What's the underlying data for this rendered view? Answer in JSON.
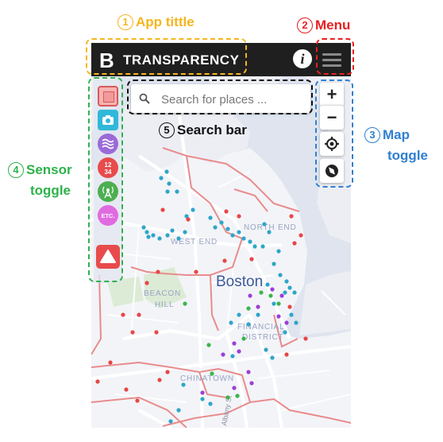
{
  "app": {
    "logo_letter": "B",
    "title": "TRANSPARENCY",
    "info_glyph": "i"
  },
  "search": {
    "placeholder": "Search for places ..."
  },
  "map_controls": {
    "zoom_in": "+",
    "zoom_out": "−"
  },
  "map_labels": {
    "city": "Boston",
    "west_end": "WEST END",
    "north_end": "NORTH END",
    "beacon_hill": [
      "BEACON",
      "HILL"
    ],
    "financial_district": [
      "FINANCIAL",
      "DISTRICT"
    ],
    "chinatown": "CHINATOWN",
    "street": "Albany St"
  },
  "sensors": [
    {
      "name": "square-sensor",
      "icon": "square-icon",
      "color": "#f4a0a0"
    },
    {
      "name": "camera-sensor",
      "icon": "camera-icon",
      "color": "#30b8d8"
    },
    {
      "name": "wave-sensor",
      "icon": "wave-icon",
      "color": "#9b6ad8"
    },
    {
      "name": "counter-sensor",
      "icon": "counter-icon",
      "color": "#e84b4b",
      "text": "12\n34"
    },
    {
      "name": "antenna-sensor",
      "icon": "antenna-icon",
      "color": "#4caf50"
    },
    {
      "name": "etc-sensor",
      "icon": "etc-icon",
      "color": "#e06be0",
      "text": "ETC."
    }
  ],
  "alert_icon": "warning-triangle-icon",
  "annotations": [
    {
      "num": "1",
      "text": "App tittle",
      "color": "#f5b51f"
    },
    {
      "num": "2",
      "text": "Menu",
      "color": "#e82020"
    },
    {
      "num": "3",
      "text": "Map",
      "text2": "toggle",
      "color": "#2f7fd0"
    },
    {
      "num": "4",
      "text": "Sensor",
      "text2": "toggle",
      "color": "#2db24a"
    },
    {
      "num": "5",
      "text": "Search bar",
      "color": "#111111"
    }
  ],
  "colors": {
    "topbar": "#1f1f1f",
    "map_water": "#dfe4ef",
    "map_land": "#f3f4f8",
    "park": "#dcebd6",
    "boundary": "#e88c8c",
    "dot_cyan": "#2ea6c8",
    "dot_red": "#e84646",
    "dot_green": "#3bb54a",
    "dot_purple": "#9b3ed8"
  }
}
